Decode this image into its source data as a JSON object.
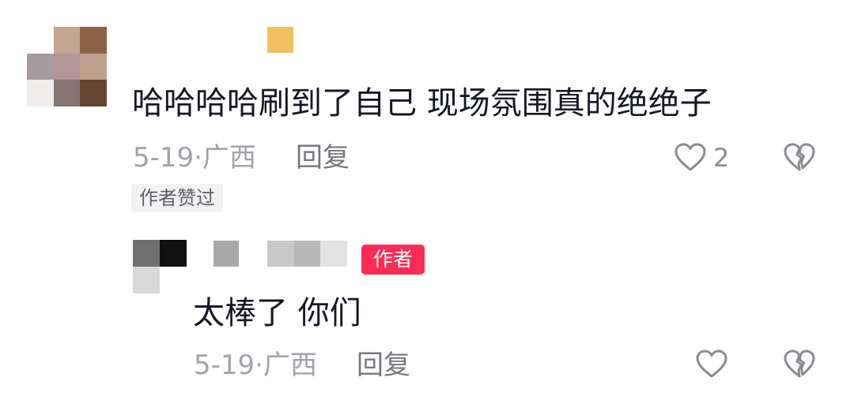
{
  "comment": {
    "text": "哈哈哈哈刷到了自己 现场氛围真的绝绝子",
    "date": "5-19",
    "separator": "·",
    "location": "广西",
    "reply_label": "回复",
    "like_count": "2",
    "liked_by_author_badge": "作者赞过",
    "avatar_colors": [
      "#ffffff",
      "#c2a593",
      "#8e6448",
      "#a59a9d",
      "#b1969a",
      "#bf9f8e",
      "#f1ecec",
      "#857572",
      "#664630"
    ],
    "username_blur_color": "#f1c162"
  },
  "reply": {
    "author_badge": "作者",
    "text": "太棒了 你们",
    "date": "5-19",
    "separator": "·",
    "location": "广西",
    "reply_label": "回复",
    "avatar_colors": [
      "#6f6f6f",
      "#111111",
      "#d9d9d9",
      "#ffffff"
    ],
    "username_blur_colors": [
      "#a8a8a8",
      "#c8c8c8",
      "#b8b8b8",
      "#e3e3e3"
    ]
  },
  "icons": {
    "like": "heart-outline-icon",
    "dislike": "broken-heart-icon"
  },
  "colors": {
    "text_primary": "#161823",
    "text_meta": "#a1a3a8",
    "reply_link": "#75777c",
    "author_badge_bg": "#fe2c55",
    "icon_stroke": "#8a8c91"
  }
}
